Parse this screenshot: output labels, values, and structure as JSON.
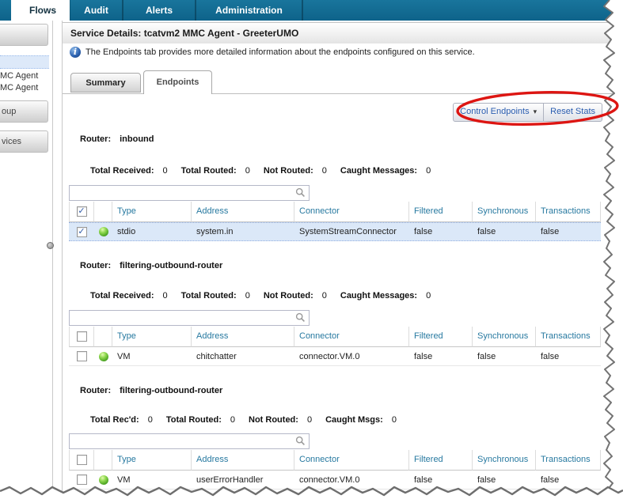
{
  "nav": {
    "tabs": [
      {
        "label": "Flows",
        "active": true
      },
      {
        "label": "Audit",
        "active": false
      },
      {
        "label": "Alerts",
        "active": false
      },
      {
        "label": "Administration",
        "active": false
      }
    ]
  },
  "sidebar": {
    "items": [
      {
        "kind": "section-box",
        "label": ""
      },
      {
        "kind": "selected-row",
        "label": ""
      },
      {
        "kind": "link",
        "label": "MC Agent"
      },
      {
        "kind": "link",
        "label": "MC Agent"
      },
      {
        "kind": "section-box",
        "label": "oup"
      },
      {
        "kind": "section-box",
        "label": "vices"
      }
    ]
  },
  "page": {
    "title": "Service Details: tcatvm2 MMC Agent - GreeterUMO"
  },
  "info": {
    "icon": "info-icon",
    "icon_glyph": "i",
    "text": "The Endpoints tab provides more detailed information about the endpoints configured on this service."
  },
  "detail_tabs": [
    {
      "label": "Summary",
      "active": false
    },
    {
      "label": "Endpoints",
      "active": true
    }
  ],
  "toolbar": {
    "control_endpoints_label": "Control Endpoints",
    "caret": "▾",
    "reset_stats_label": "Reset Stats"
  },
  "annotation": {
    "shape": "ellipse",
    "color": "#DD1512"
  },
  "search": {
    "value": "",
    "placeholder": ""
  },
  "columns": [
    "Type",
    "Address",
    "Connector",
    "Filtered",
    "Synchronous",
    "Transactions"
  ],
  "sections": [
    {
      "router_label": "Router:",
      "router_name": "inbound",
      "stats": [
        {
          "label": "Total Received:",
          "value": "0"
        },
        {
          "label": "Total Routed:",
          "value": "0"
        },
        {
          "label": "Not Routed:",
          "value": "0"
        },
        {
          "label": "Caught Messages:",
          "value": "0"
        }
      ],
      "header_check": "✓",
      "rows": [
        {
          "check": "✓",
          "selected": true,
          "status_icon": "green-status-icon",
          "type": "stdio",
          "address": "system.in",
          "connector": "SystemStreamConnector",
          "filtered": "false",
          "synchronous": "false",
          "transactions": "false"
        }
      ]
    },
    {
      "router_label": "Router:",
      "router_name": "filtering-outbound-router",
      "stats": [
        {
          "label": "Total Received:",
          "value": "0"
        },
        {
          "label": "Total Routed:",
          "value": "0"
        },
        {
          "label": "Not Routed:",
          "value": "0"
        },
        {
          "label": "Caught Messages:",
          "value": "0"
        }
      ],
      "header_check": "",
      "rows": [
        {
          "check": "",
          "selected": false,
          "status_icon": "green-status-icon",
          "type": "VM",
          "address": "chitchatter",
          "connector": "connector.VM.0",
          "filtered": "false",
          "synchronous": "false",
          "transactions": "false"
        }
      ]
    },
    {
      "router_label": "Router:",
      "router_name": "filtering-outbound-router",
      "stats": [
        {
          "label": "Total Rec'd:",
          "value": "0"
        },
        {
          "label": "Total Routed:",
          "value": "0"
        },
        {
          "label": "Not Routed:",
          "value": "0"
        },
        {
          "label": "Caught Msgs:",
          "value": "0"
        }
      ],
      "header_check": "",
      "rows": [
        {
          "check": "",
          "selected": false,
          "status_icon": "green-status-icon",
          "type": "VM",
          "address": "userErrorHandler",
          "connector": "connector.VM.0",
          "filtered": "false",
          "synchronous": "false",
          "transactions": "false"
        }
      ]
    }
  ],
  "colors": {
    "nav_teal": "#11698E",
    "selection_blue": "#DBE8F8",
    "column_header_text": "#2779A0",
    "button_text": "#2A5DB0",
    "status_green": "#4CA423",
    "annotation_red": "#DD1512"
  }
}
